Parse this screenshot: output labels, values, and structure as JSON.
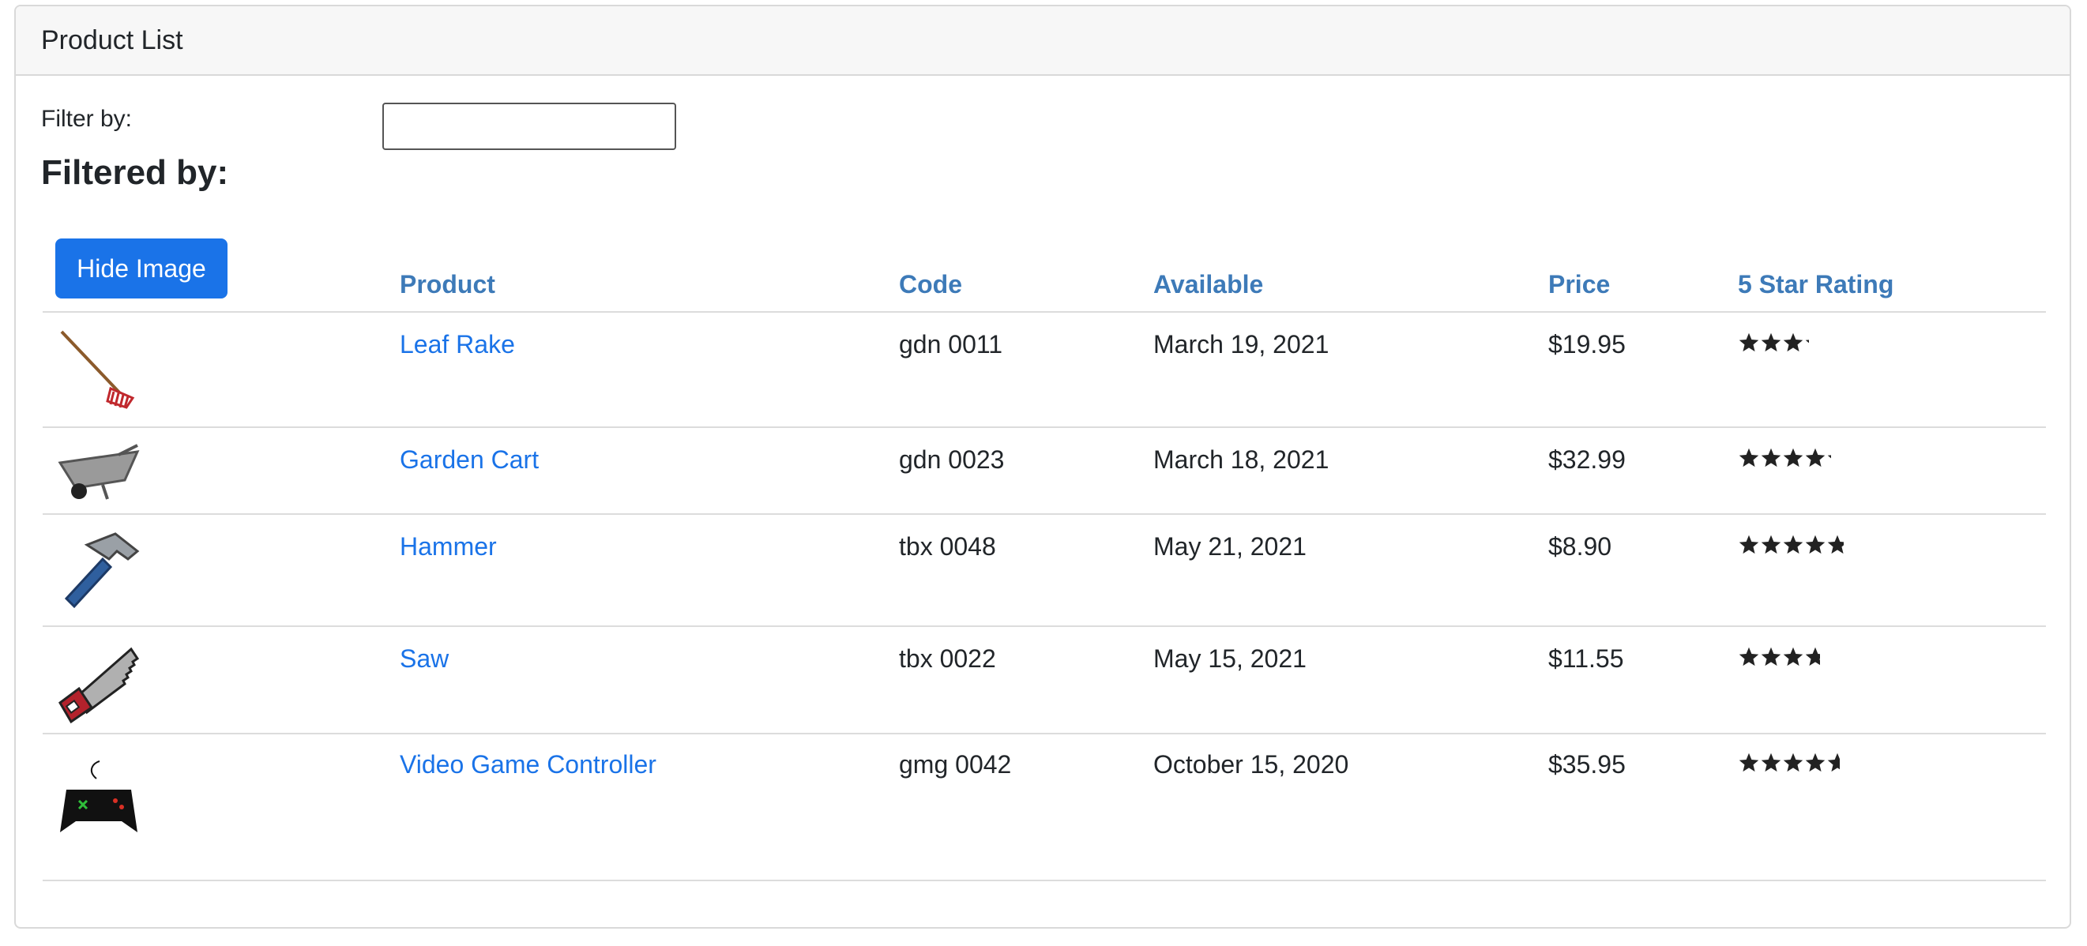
{
  "header": {
    "title": "Product List"
  },
  "filter": {
    "label": "Filter by:",
    "value": "",
    "filtered_by": "Filtered by:"
  },
  "table": {
    "hide_image_label": "Hide Image",
    "columns": [
      "Product",
      "Code",
      "Available",
      "Price",
      "5 Star Rating"
    ],
    "rows": [
      {
        "name": "Leaf Rake",
        "code": "gdn 0011",
        "available": "March 19, 2021",
        "price": "$19.95",
        "rating": 3.2,
        "image": "leaf-rake-image"
      },
      {
        "name": "Garden Cart",
        "code": "gdn 0023",
        "available": "March 18, 2021",
        "price": "$32.99",
        "rating": 4.2,
        "image": "garden-cart-image"
      },
      {
        "name": "Hammer",
        "code": "tbx 0048",
        "available": "May 21, 2021",
        "price": "$8.90",
        "rating": 4.8,
        "image": "hammer-image"
      },
      {
        "name": "Saw",
        "code": "tbx 0022",
        "available": "May 15, 2021",
        "price": "$11.55",
        "rating": 3.7,
        "image": "saw-image"
      },
      {
        "name": "Video Game Controller",
        "code": "gmg 0042",
        "available": "October 15, 2020",
        "price": "$35.95",
        "rating": 4.6,
        "image": "video-game-controller-image"
      }
    ]
  },
  "colors": {
    "link": "#1a73e8",
    "header_link": "#3d7ab8",
    "button": "#1a73e8",
    "star": "#222222"
  }
}
